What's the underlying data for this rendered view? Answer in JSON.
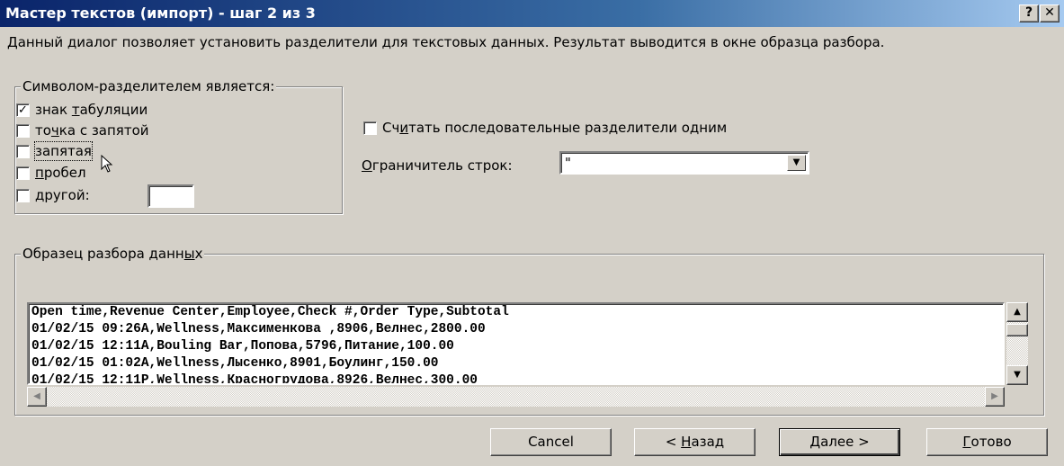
{
  "window": {
    "title": "Мастер текстов (импорт) - шаг 2 из 3",
    "help_btn": "?",
    "close_btn": "✕"
  },
  "description": "Данный диалог позволяет установить разделители для текстовых данных. Результат выводится в окне образца разбора.",
  "delimiters": {
    "legend": "Символом-разделителем является:",
    "tab": {
      "label": "знак табуляции",
      "checked": true
    },
    "semicolon": {
      "label": "точка с запятой",
      "checked": false
    },
    "comma": {
      "label": "запятая",
      "checked": false
    },
    "space": {
      "label": "пробел",
      "checked": false
    },
    "other": {
      "label": "другой:",
      "checked": false,
      "value": ""
    }
  },
  "consecutive": {
    "label": "Считать последовательные разделители одним",
    "checked": false
  },
  "qualifier": {
    "label": "Ограничитель строк:",
    "value": "\""
  },
  "preview": {
    "legend": "Образец разбора данных",
    "rows": [
      "Open time,Revenue Center,Employee,Check #,Order Type,Subtotal",
      "01/02/15 09:26A,Wellness,Максименкова ,8906,Велнес,2800.00",
      "01/02/15 12:11A,Bouling Bar,Попова,5796,Питание,100.00",
      "01/02/15 01:02A,Wellness,Лысенко,8901,Боулинг,150.00",
      "01/02/15 12:11P,Wellness,Красногрудова,8926,Велнес,300.00"
    ]
  },
  "buttons": {
    "cancel": "Cancel",
    "back": "< Назад",
    "next": "Далее >",
    "finish": "Готово"
  },
  "icons": {
    "checkmark": "checkmark-icon",
    "arrow": "arrow-cursor-icon"
  }
}
